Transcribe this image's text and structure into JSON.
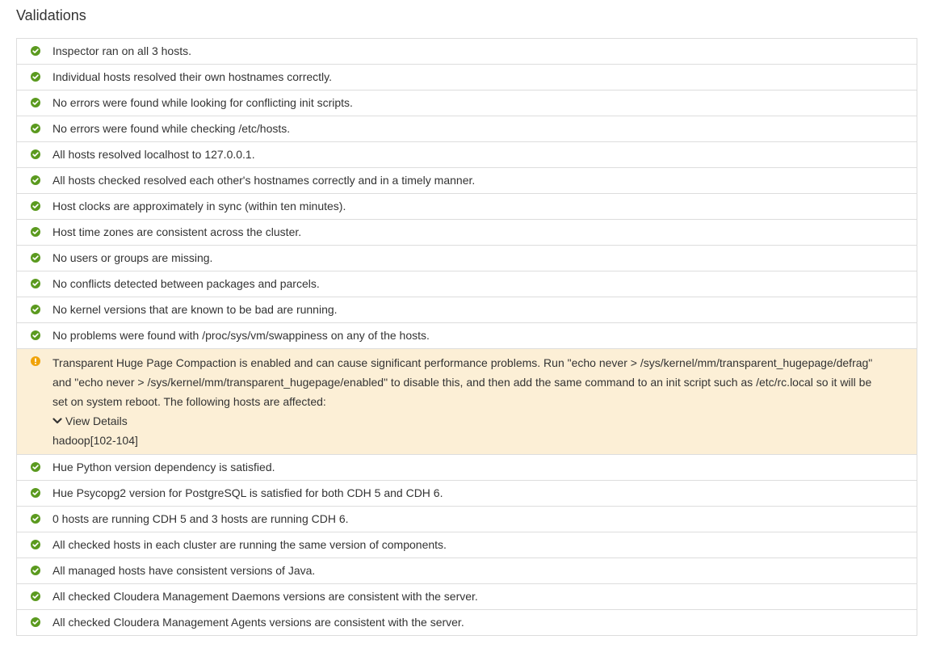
{
  "page": {
    "title": "Validations"
  },
  "colors": {
    "success": "#5b9a1f",
    "warning": "#f0a30a",
    "warning_background": "#fcefd6",
    "border": "#dddddd"
  },
  "validations": [
    {
      "status": "success",
      "icon": "check-circle-icon",
      "message": "Inspector ran on all 3 hosts."
    },
    {
      "status": "success",
      "icon": "check-circle-icon",
      "message": "Individual hosts resolved their own hostnames correctly."
    },
    {
      "status": "success",
      "icon": "check-circle-icon",
      "message": "No errors were found while looking for conflicting init scripts."
    },
    {
      "status": "success",
      "icon": "check-circle-icon",
      "message": "No errors were found while checking /etc/hosts."
    },
    {
      "status": "success",
      "icon": "check-circle-icon",
      "message": "All hosts resolved localhost to 127.0.0.1."
    },
    {
      "status": "success",
      "icon": "check-circle-icon",
      "message": "All hosts checked resolved each other's hostnames correctly and in a timely manner."
    },
    {
      "status": "success",
      "icon": "check-circle-icon",
      "message": "Host clocks are approximately in sync (within ten minutes)."
    },
    {
      "status": "success",
      "icon": "check-circle-icon",
      "message": "Host time zones are consistent across the cluster."
    },
    {
      "status": "success",
      "icon": "check-circle-icon",
      "message": "No users or groups are missing."
    },
    {
      "status": "success",
      "icon": "check-circle-icon",
      "message": "No conflicts detected between packages and parcels."
    },
    {
      "status": "success",
      "icon": "check-circle-icon",
      "message": "No kernel versions that are known to be bad are running."
    },
    {
      "status": "success",
      "icon": "check-circle-icon",
      "message": "No problems were found with /proc/sys/vm/swappiness on any of the hosts."
    },
    {
      "status": "warning",
      "icon": "exclamation-circle-icon",
      "message": "Transparent Huge Page Compaction is enabled and can cause significant performance problems. Run \"echo never > /sys/kernel/mm/transparent_hugepage/defrag\" and \"echo never > /sys/kernel/mm/transparent_hugepage/enabled\" to disable this, and then add the same command to an init script such as /etc/rc.local so it will be set on system reboot. The following hosts are affected:",
      "details_label": "View Details",
      "details_icon": "chevron-down-icon",
      "affected_hosts": "hadoop[102-104]"
    },
    {
      "status": "success",
      "icon": "check-circle-icon",
      "message": "Hue Python version dependency is satisfied."
    },
    {
      "status": "success",
      "icon": "check-circle-icon",
      "message": "Hue Psycopg2 version for PostgreSQL is satisfied for both CDH 5 and CDH 6."
    },
    {
      "status": "success",
      "icon": "check-circle-icon",
      "message": "0 hosts are running CDH 5 and 3 hosts are running CDH 6."
    },
    {
      "status": "success",
      "icon": "check-circle-icon",
      "message": "All checked hosts in each cluster are running the same version of components."
    },
    {
      "status": "success",
      "icon": "check-circle-icon",
      "message": "All managed hosts have consistent versions of Java."
    },
    {
      "status": "success",
      "icon": "check-circle-icon",
      "message": "All checked Cloudera Management Daemons versions are consistent with the server."
    },
    {
      "status": "success",
      "icon": "check-circle-icon",
      "message": "All checked Cloudera Management Agents versions are consistent with the server."
    }
  ]
}
